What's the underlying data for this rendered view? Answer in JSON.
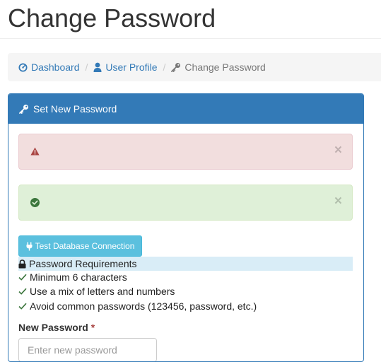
{
  "page": {
    "title": "Change Password"
  },
  "breadcrumb": [
    {
      "label": "Dashboard",
      "icon": "dashboard-icon"
    },
    {
      "label": "User Profile",
      "icon": "user-icon"
    },
    {
      "label": "Change Password",
      "icon": "key-icon"
    }
  ],
  "breadcrumb_separator": "/",
  "panel": {
    "title": "Set New Password",
    "icon": "key-icon",
    "alert_danger": {
      "icon": "warning-icon",
      "close": "×"
    },
    "alert_success": {
      "icon": "check-circle-icon",
      "close": "×"
    },
    "test_button": {
      "label": "Test Database Connection",
      "icon": "plug-icon"
    },
    "requirements": {
      "title": "Password Requirements",
      "items": [
        "Minimum 6 characters",
        "Use a mix of letters and numbers",
        "Avoid common passwords (123456, password, etc.)"
      ]
    },
    "new_password": {
      "label": "New Password",
      "required_mark": "*",
      "placeholder": "Enter new password"
    }
  },
  "colors": {
    "primary": "#337ab7",
    "danger_bg": "#f2dede",
    "danger_icon": "#a94442",
    "success_bg": "#dff0d8",
    "success_icon": "#3c763d",
    "info": "#5bc0de",
    "info_bg": "#d9edf7"
  }
}
